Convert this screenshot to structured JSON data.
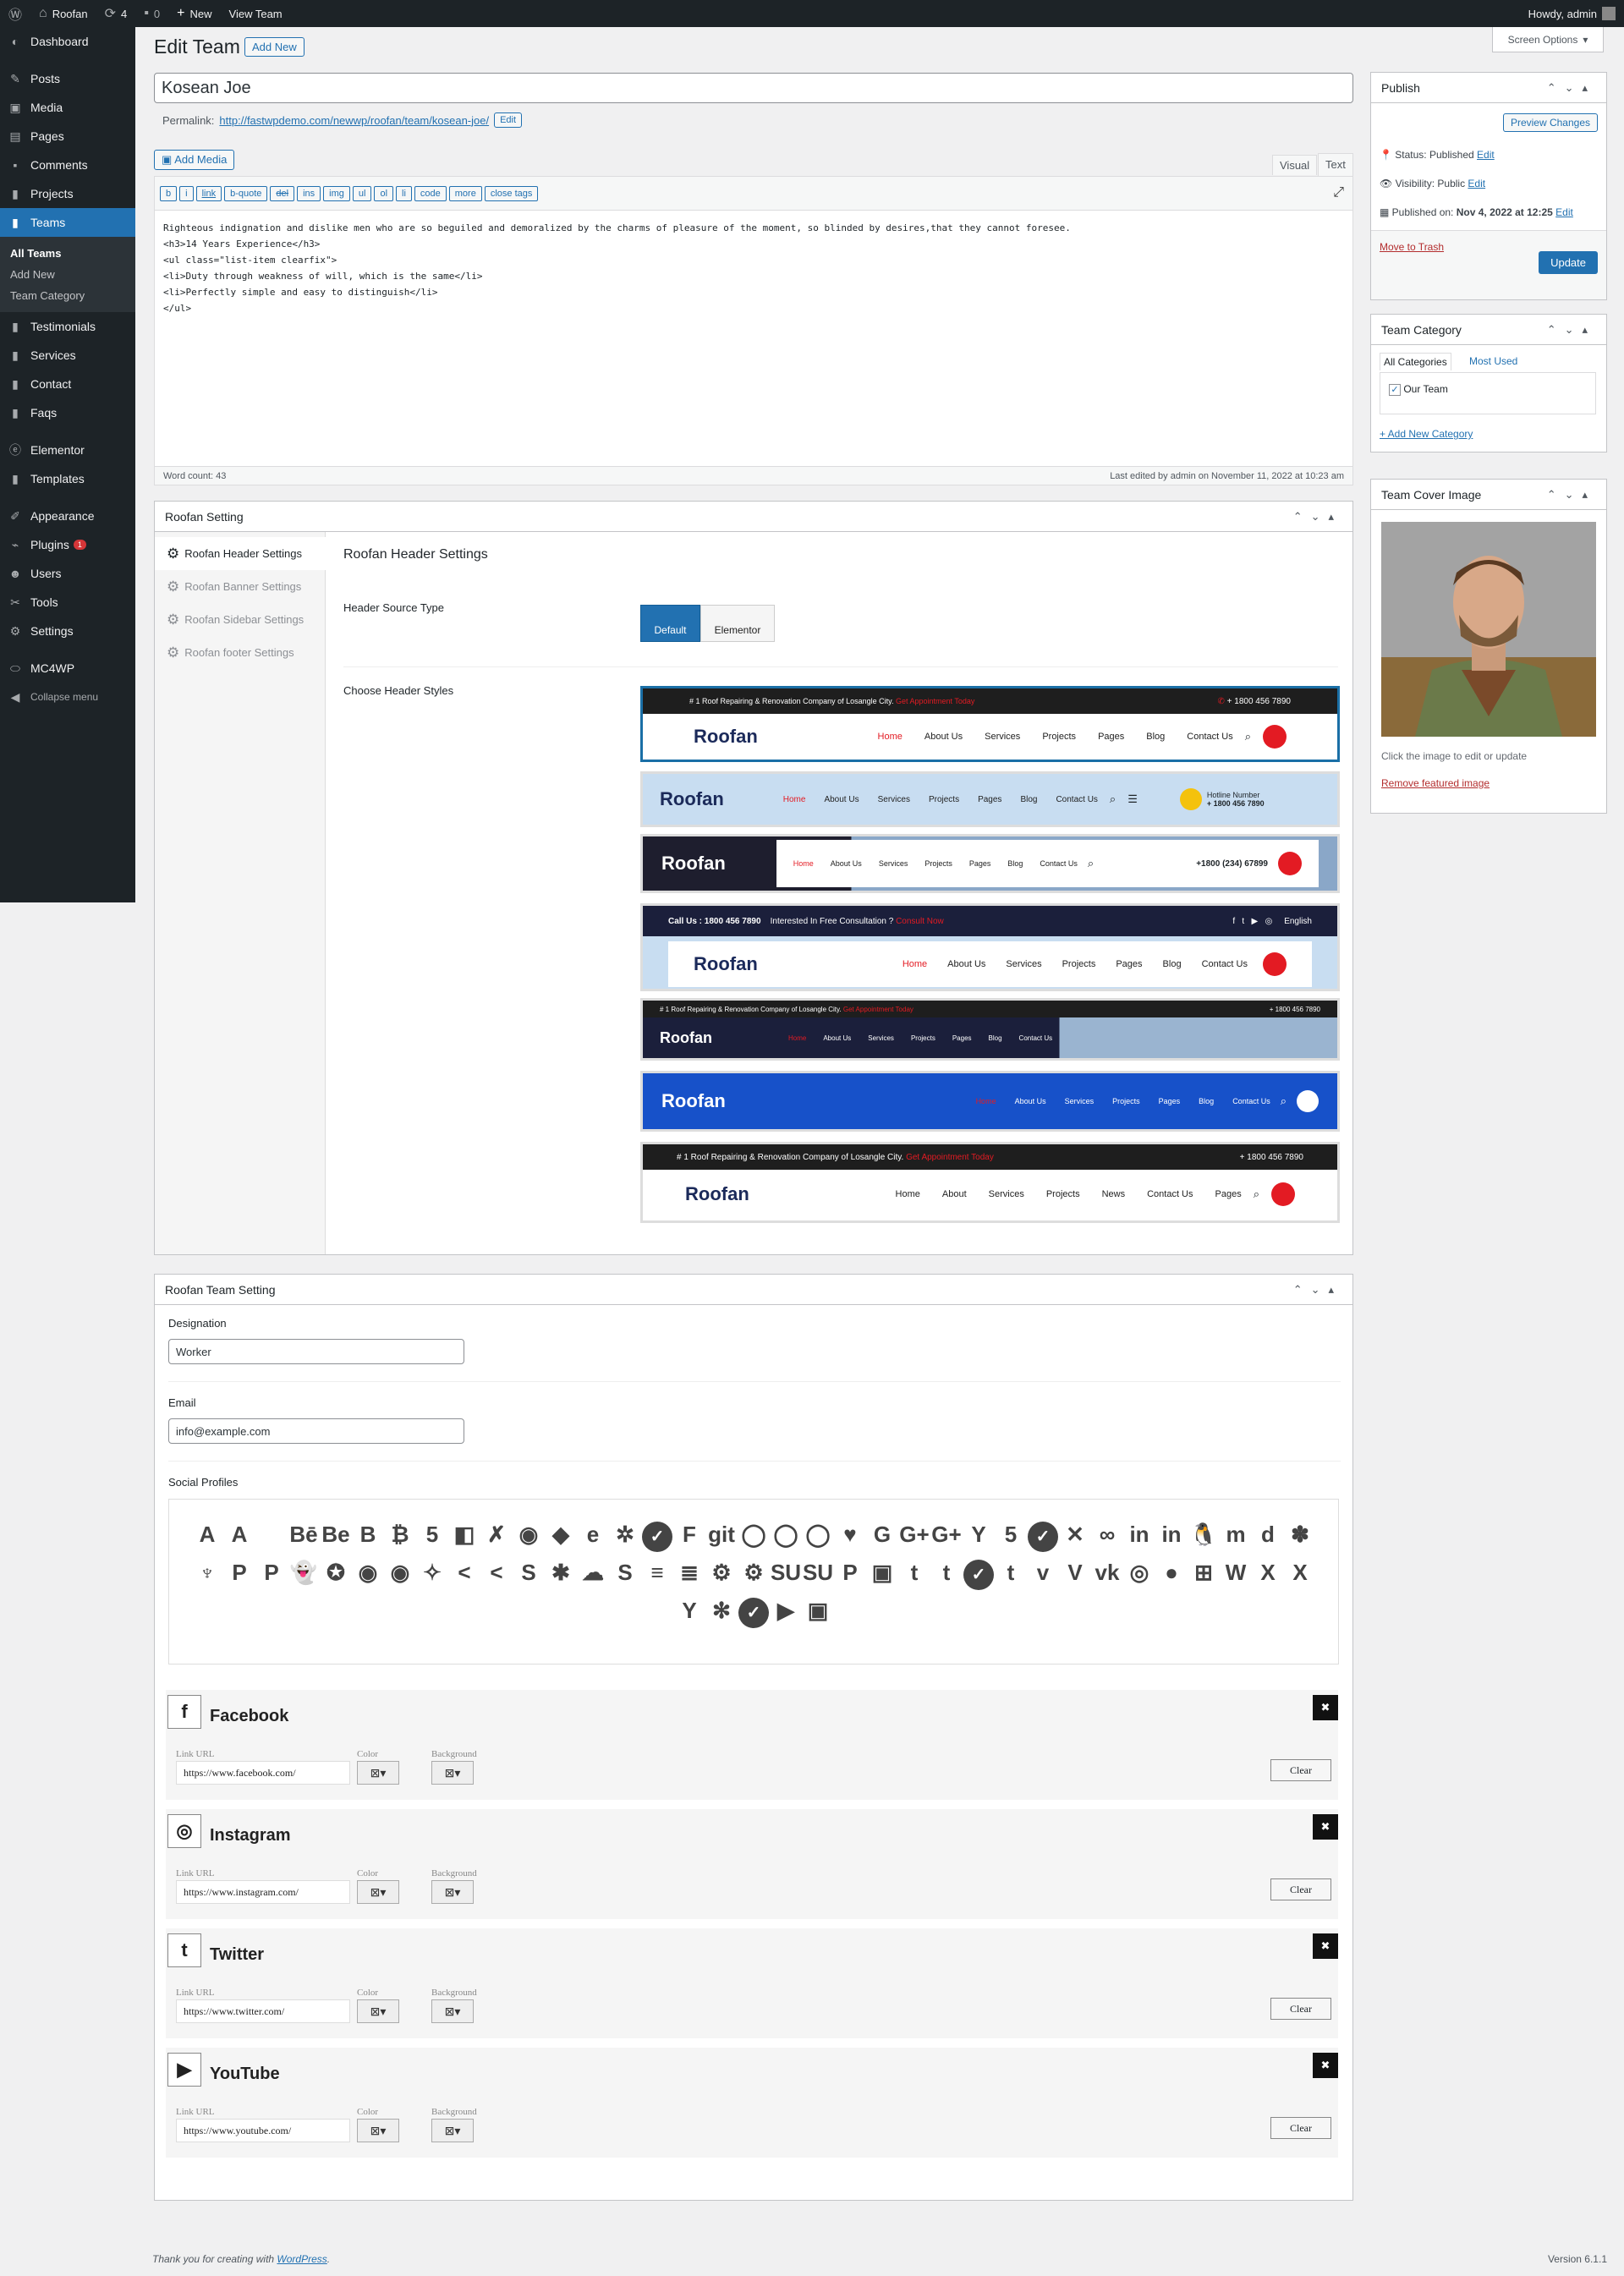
{
  "adminbar": {
    "site": "Roofan",
    "updates": "4",
    "comments": "0",
    "new": "New",
    "view": "View Team",
    "howdy": "Howdy, admin"
  },
  "sidebar": {
    "items": [
      {
        "label": "Dashboard",
        "icon": "dashboard-icon"
      },
      {
        "label": "Posts",
        "icon": "pin-icon"
      },
      {
        "label": "Media",
        "icon": "media-icon"
      },
      {
        "label": "Pages",
        "icon": "page-icon"
      },
      {
        "label": "Comments",
        "icon": "comment-icon"
      },
      {
        "label": "Projects",
        "icon": "folder-icon"
      },
      {
        "label": "Teams",
        "icon": "folder-icon"
      },
      {
        "label": "Testimonials",
        "icon": "folder-icon"
      },
      {
        "label": "Services",
        "icon": "folder-icon"
      },
      {
        "label": "Contact",
        "icon": "folder-icon"
      },
      {
        "label": "Faqs",
        "icon": "folder-icon"
      },
      {
        "label": "Elementor",
        "icon": "elementor-icon"
      },
      {
        "label": "Templates",
        "icon": "folder-icon"
      },
      {
        "label": "Appearance",
        "icon": "brush-icon"
      },
      {
        "label": "Plugins",
        "icon": "plugin-icon",
        "badge": "1"
      },
      {
        "label": "Users",
        "icon": "user-icon"
      },
      {
        "label": "Tools",
        "icon": "wrench-icon"
      },
      {
        "label": "Settings",
        "icon": "settings-icon"
      },
      {
        "label": "MC4WP",
        "icon": "mc4wp-icon"
      },
      {
        "label": "Collapse menu",
        "icon": "collapse-icon"
      }
    ],
    "submenu": [
      "All Teams",
      "Add New",
      "Team Category"
    ]
  },
  "header": {
    "title": "Edit Team",
    "add_new": "Add New",
    "screen_options": "Screen Options"
  },
  "post": {
    "title": "Kosean Joe",
    "permalink_label": "Permalink:",
    "permalink": "http://fastwpdemo.com/newwp/roofan/team/kosean-joe/",
    "edit": "Edit"
  },
  "editor": {
    "add_media": "Add Media",
    "tab_visual": "Visual",
    "tab_text": "Text",
    "quicktags": [
      "b",
      "i",
      "link",
      "b-quote",
      "del",
      "ins",
      "img",
      "ul",
      "ol",
      "li",
      "code",
      "more",
      "close tags"
    ],
    "content": "Righteous indignation and dislike men who are so beguiled and demoralized by the charms of pleasure of the moment, so blinded by desires,that they cannot foresee.\n<h3>14 Years Experience</h3>\n<ul class=\"list-item clearfix\">\n<li>Duty through weakness of will, which is the same</li>\n<li>Perfectly simple and easy to distinguish</li>\n</ul>",
    "word_count": "Word count: 43",
    "last_edited": "Last edited by admin on November 11, 2022 at 10:23 am"
  },
  "roofan_setting": {
    "title": "Roofan Setting",
    "tabs": [
      "Roofan Header Settings",
      "Roofan Banner Settings",
      "Roofan Sidebar Settings",
      "Roofan footer Settings"
    ],
    "heading": "Roofan Header Settings",
    "source_label": "Header Source Type",
    "opt_default": "Default",
    "opt_elementor": "Elementor",
    "styles_label": "Choose Header Styles"
  },
  "header_styles": {
    "tagline": "# 1 Roof Repairing & Renovation Company of Losangle City.",
    "appointment": "Get Appointment Today",
    "phone": "+ 1800 456 7890",
    "brand": "Roofan",
    "nav": [
      "Home",
      "About Us",
      "Services",
      "Projects",
      "Pages",
      "Blog",
      "Contact Us"
    ],
    "hotline_label": "Hotline Number",
    "hotline": "+ 1800 456 7890",
    "phone3": "+1800 (234) 67899",
    "call": "Call Us : 1800 456 7890",
    "consult": "Interested In Free Consultation ?",
    "consult_link": "Consult Now",
    "lang": "English",
    "nav7": [
      "Home",
      "About",
      "Services",
      "Projects",
      "News",
      "Contact Us",
      "Pages"
    ]
  },
  "team_setting": {
    "title": "Roofan Team Setting",
    "designation_label": "Designation",
    "designation": "Worker",
    "email_label": "Email",
    "email": "info@example.com",
    "social_label": "Social Profiles"
  },
  "social_icons": [
    "A",
    "A",
    "",
    "Bē",
    "Be",
    "B",
    "₿",
    "5",
    "◧",
    "✗",
    "◉",
    "◆",
    "e",
    "✲",
    "✓",
    "F",
    "git",
    "◯",
    "◯",
    "◯",
    "♥",
    "G",
    "G+",
    "G+",
    "Y",
    "5",
    "✓",
    "✕",
    "∞",
    "in",
    "in",
    "🐧",
    "m",
    "d",
    "✽",
    "♆",
    "P",
    "P",
    "👻",
    "✪",
    "◉",
    "◉",
    "✧",
    "<",
    "<",
    "S",
    "✱",
    "☁",
    "S",
    "≡",
    "≣",
    "⚙",
    "⚙",
    "SU",
    "SU",
    "P",
    "▣",
    "t",
    "t",
    "✓",
    "t",
    "v",
    "V",
    "vk",
    "◎",
    "●",
    "⊞",
    "W",
    "X",
    "X",
    "Y",
    "✻",
    "✓",
    "▶",
    "▣"
  ],
  "profiles": [
    {
      "name": "Facebook",
      "icon": "f",
      "url": "https://www.facebook.com/"
    },
    {
      "name": "Instagram",
      "icon": "◎",
      "url": "https://www.instagram.com/"
    },
    {
      "name": "Twitter",
      "icon": "t",
      "url": "https://www.twitter.com/"
    },
    {
      "name": "YouTube",
      "icon": "▶",
      "url": "https://www.youtube.com/"
    }
  ],
  "profile_labels": {
    "link": "Link URL",
    "color": "Color",
    "background": "Background",
    "clear": "Clear"
  },
  "publish": {
    "title": "Publish",
    "preview": "Preview Changes",
    "status_label": "Status:",
    "status": "Published",
    "visibility_label": "Visibility:",
    "visibility": "Public",
    "published_label": "Published on:",
    "published": "Nov 4, 2022 at 12:25",
    "edit": "Edit",
    "trash": "Move to Trash",
    "update": "Update"
  },
  "category": {
    "title": "Team Category",
    "tab_all": "All Categories",
    "tab_used": "Most Used",
    "item": "Our Team",
    "add_new": "+ Add New Category"
  },
  "cover": {
    "title": "Team Cover Image",
    "hint": "Click the image to edit or update",
    "remove": "Remove featured image"
  },
  "footer": {
    "thanks": "Thank you for creating with",
    "wp": "WordPress",
    "version": "Version 6.1.1"
  }
}
